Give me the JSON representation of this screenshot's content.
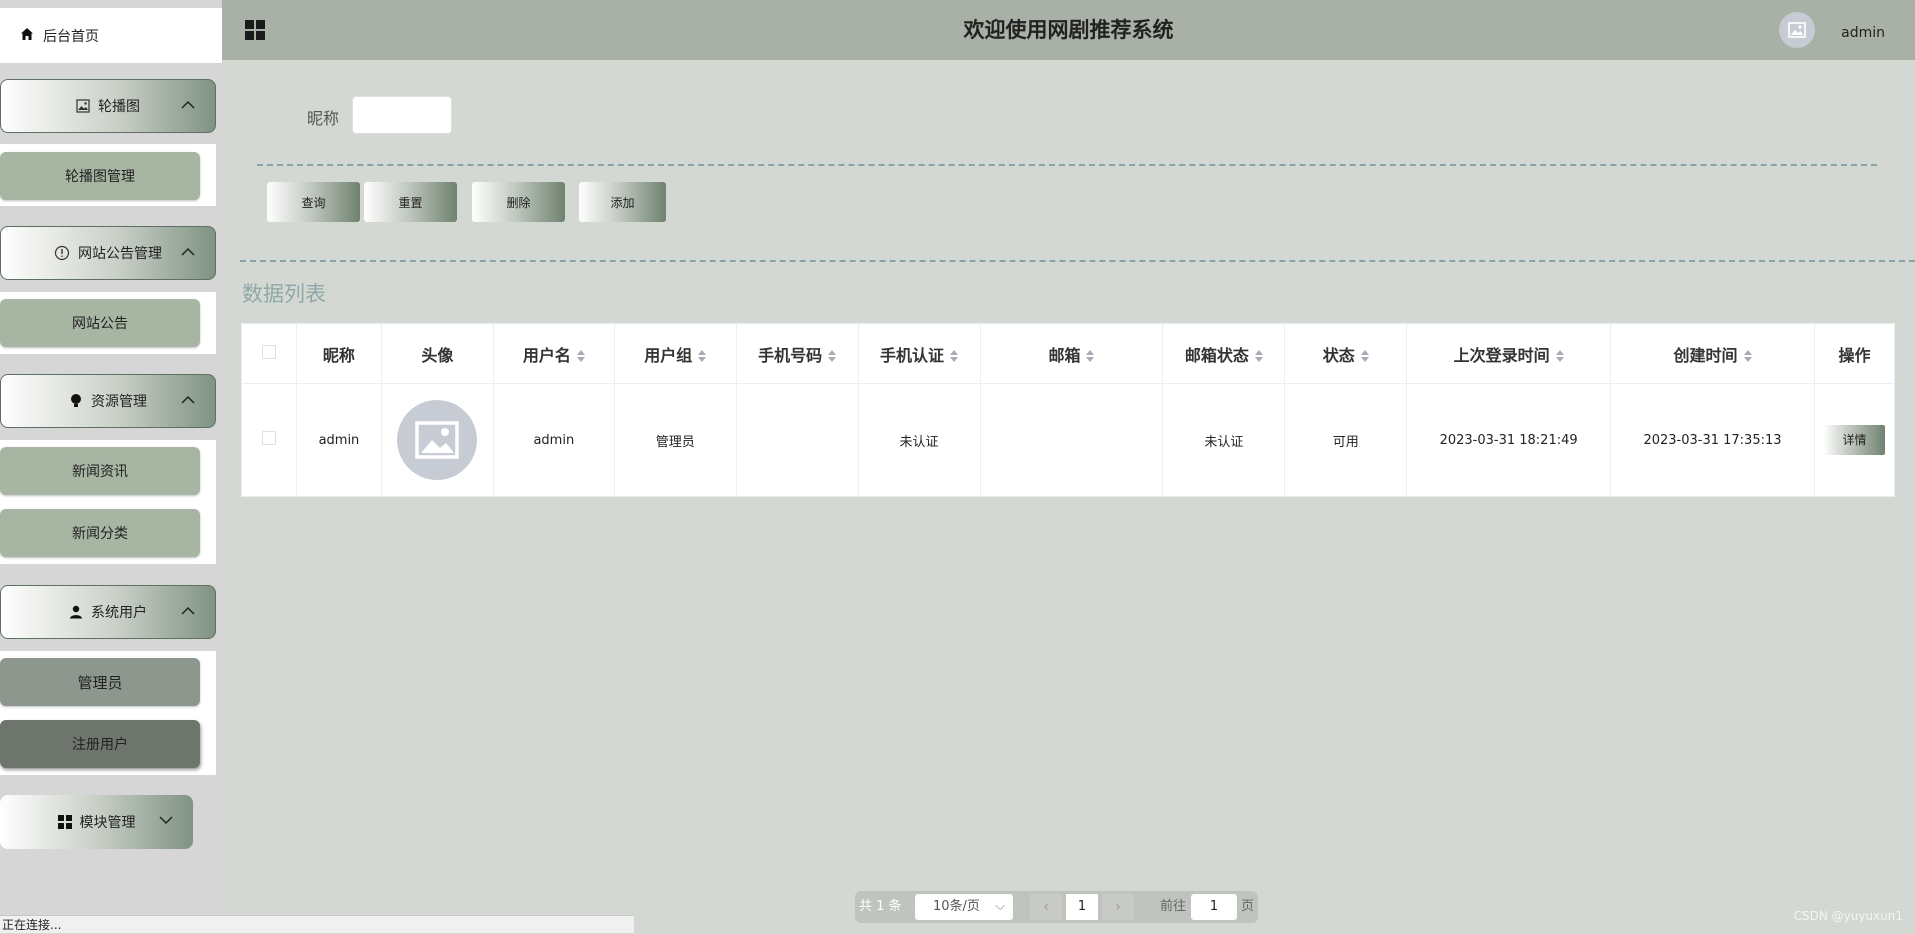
{
  "header": {
    "title": "欢迎使用网剧推荐系统",
    "user": "admin"
  },
  "sidebar": {
    "home": "后台首页",
    "groups": [
      {
        "label": "轮播图",
        "icon": "picture-icon",
        "items": [
          "轮播图管理"
        ]
      },
      {
        "label": "网站公告管理",
        "icon": "info-icon",
        "items": [
          "网站公告"
        ]
      },
      {
        "label": "资源管理",
        "icon": "bulb-icon",
        "items": [
          "新闻资讯",
          "新闻分类"
        ]
      },
      {
        "label": "系统用户",
        "icon": "user-icon",
        "items": [
          "管理员",
          "注册用户"
        ]
      },
      {
        "label": "模块管理",
        "icon": "grid-icon",
        "items": []
      }
    ]
  },
  "search": {
    "label": "昵称",
    "value": ""
  },
  "buttons": {
    "query": "查询",
    "reset": "重置",
    "delete": "删除",
    "add": "添加"
  },
  "list_title": "数据列表",
  "table": {
    "columns": [
      "昵称",
      "头像",
      "用户名",
      "用户组",
      "手机号码",
      "手机认证",
      "邮箱",
      "邮箱状态",
      "状态",
      "上次登录时间",
      "创建时间",
      "操作"
    ],
    "rows": [
      {
        "nickname": "admin",
        "username": "admin",
        "group": "管理员",
        "phone": "",
        "phone_auth": "未认证",
        "email": "",
        "email_status": "未认证",
        "status": "可用",
        "last_login": "2023-03-31 18:21:49",
        "created": "2023-03-31 17:35:13",
        "action": "详情"
      }
    ]
  },
  "pagination": {
    "total": "共 1 条",
    "page_size": "10条/页",
    "current": "1",
    "goto_label": "前往",
    "goto_value": "1",
    "page_word": "页"
  },
  "status_bar": "正在连接...",
  "watermark": "CSDN @yuyuxun1",
  "colors": {
    "header_bg": "#a9b1a6",
    "main_bg": "#d3d8d2",
    "sub_item": "#a7b5a3",
    "accent_title": "#8fa8aa"
  }
}
